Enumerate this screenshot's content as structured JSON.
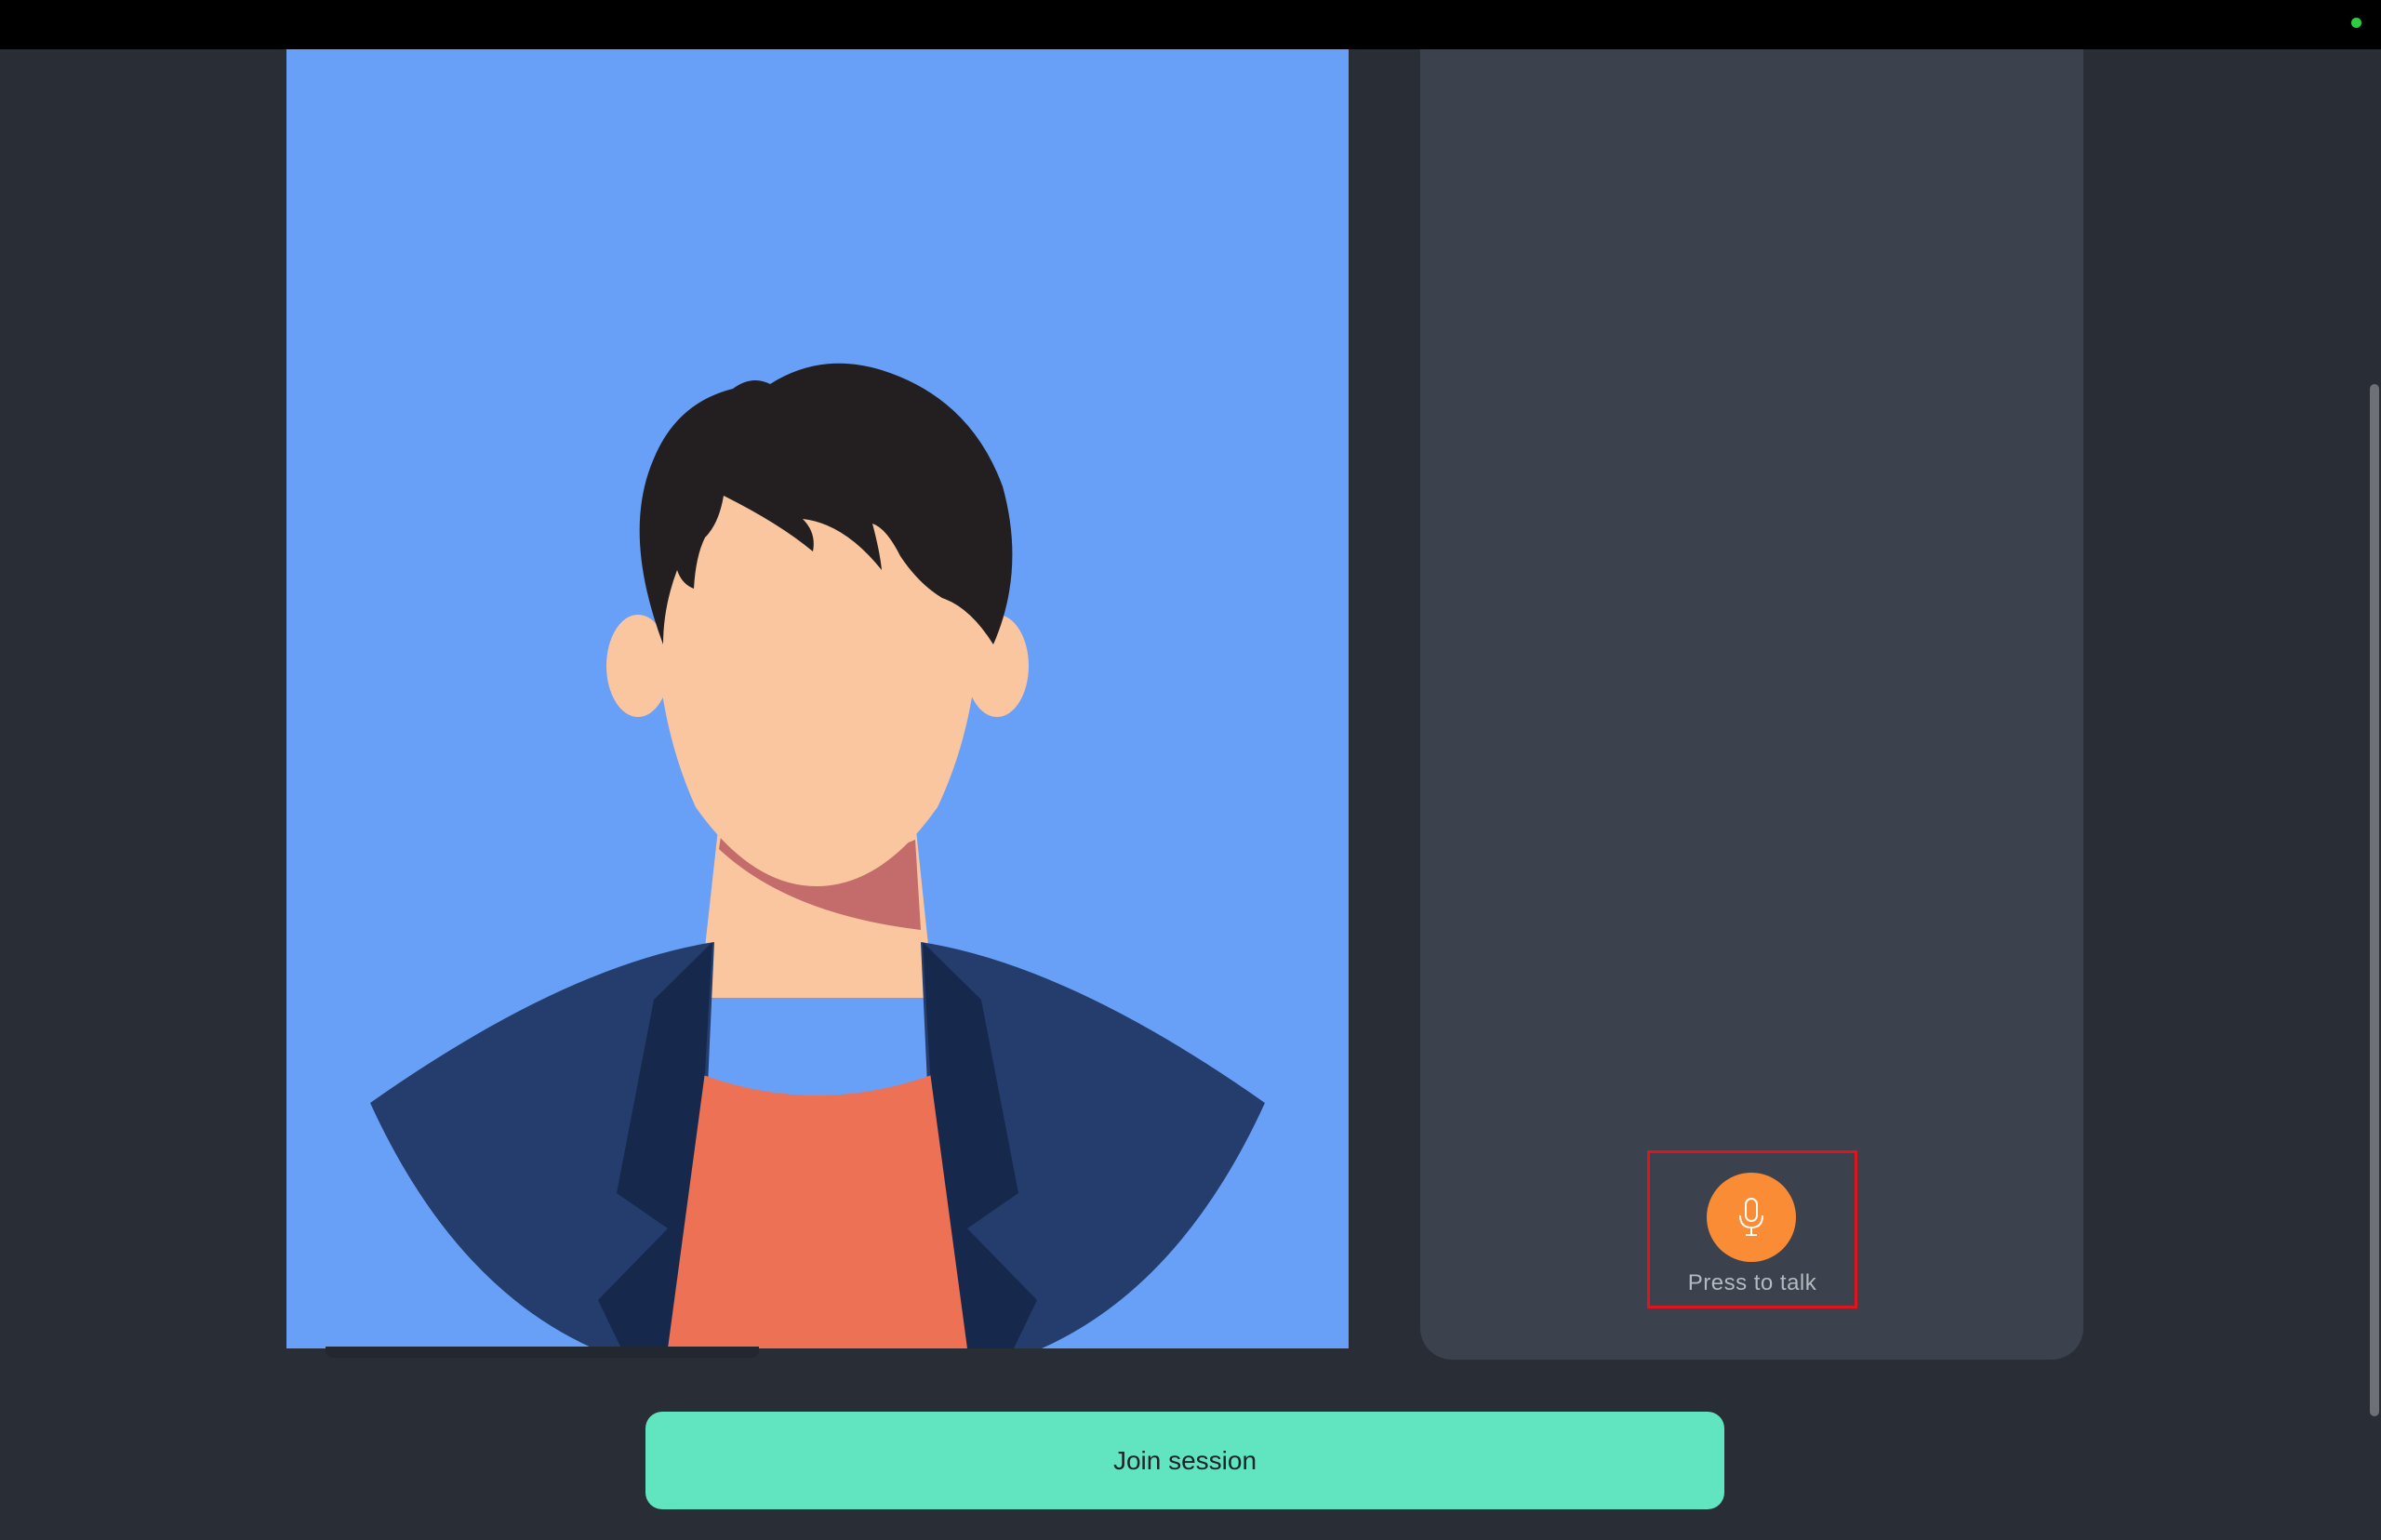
{
  "colors": {
    "background": "#282d36",
    "top_bar": "#000000",
    "status_dot": "#2ecc40",
    "chat_panel": "#3c424d",
    "avatar_background": "#68a0f8",
    "mic_button": "#fb8c36",
    "mic_icon": "#ffffff",
    "talk_label": "#b4b8c0",
    "join_button": "#61e5c0",
    "join_label": "#1e232a",
    "highlight_border": "#e0141c"
  },
  "avatar": {
    "icon": "person-avatar-illustration"
  },
  "talk": {
    "icon": "microphone-icon",
    "label": "Press to talk"
  },
  "join": {
    "label": "Join session"
  }
}
